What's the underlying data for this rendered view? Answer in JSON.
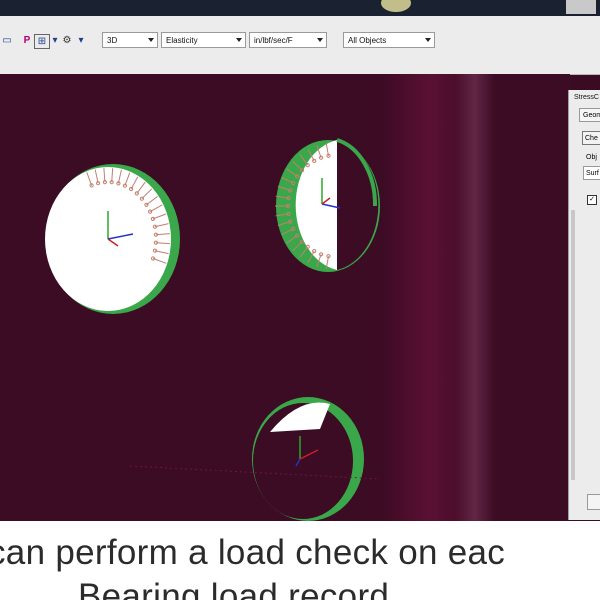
{
  "toolbar": {
    "view_mode": "3D",
    "property": "Elasticity",
    "units": "in/lbf/sec/F",
    "object_filter": "All Objects",
    "icon_p_label": "P"
  },
  "panel": {
    "title": "StressC",
    "tab_label": "Geom",
    "check_button_label": "Che",
    "object_label": "Obj",
    "object_field_value": "Surf",
    "checkbox_checked": "✓"
  },
  "caption": {
    "line1": "can perform a load check on eac",
    "line2": "Bearing load record"
  },
  "colors": {
    "background": "#3c0b24",
    "hole_fill": "#ffffff",
    "hole_rim": "#3aa84a",
    "load_arrow": "#c27f6e",
    "axis_x": "#2233cc",
    "axis_y": "#2aa82a",
    "axis_z": "#cc2222"
  }
}
